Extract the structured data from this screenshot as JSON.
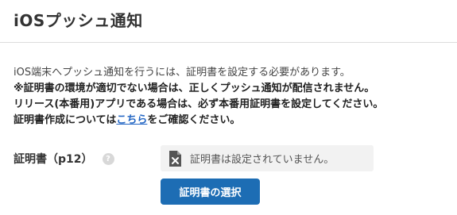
{
  "section": {
    "title": "iOSプッシュ通知"
  },
  "description": {
    "line1": "iOS端末へプッシュ通知を行うには、証明書を設定する必要があります。",
    "line2": "※証明書の環境が適切でない場合は、正しくプッシュ通知が配信されません。",
    "line3": "リリース(本番用)アプリである場合は、必ず本番用証明書を設定してください。",
    "line4_before": "証明書作成については",
    "line4_link": "こちら",
    "line4_after": "をご確認ください。"
  },
  "certificate": {
    "label": "証明書（p12）",
    "help_icon_text": "?",
    "status_icon": "file-x-icon",
    "status_text": "証明書は設定されていません。",
    "select_button_label": "証明書の選択"
  },
  "colors": {
    "primary_button": "#1d6db4",
    "link": "#2366c4"
  }
}
